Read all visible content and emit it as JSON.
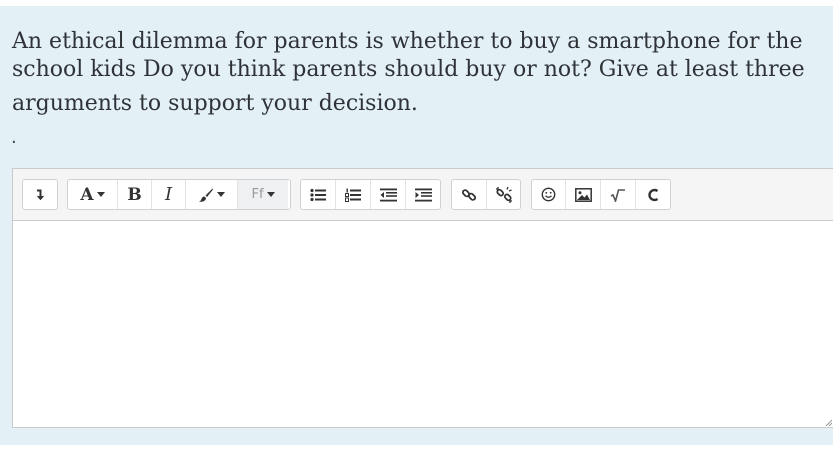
{
  "question": {
    "line1": "An ethical dilemma for parents is whether to buy a smartphone for the",
    "line2": "school kids Do you think parents should buy or not? Give at least three",
    "line3": "arguments to support your decision.",
    "trailing": "."
  },
  "toolbar": {
    "font_size_label": "A",
    "bold_label": "B",
    "italic_label": "I",
    "font_family_label": "Ff"
  },
  "editor": {
    "value": ""
  }
}
